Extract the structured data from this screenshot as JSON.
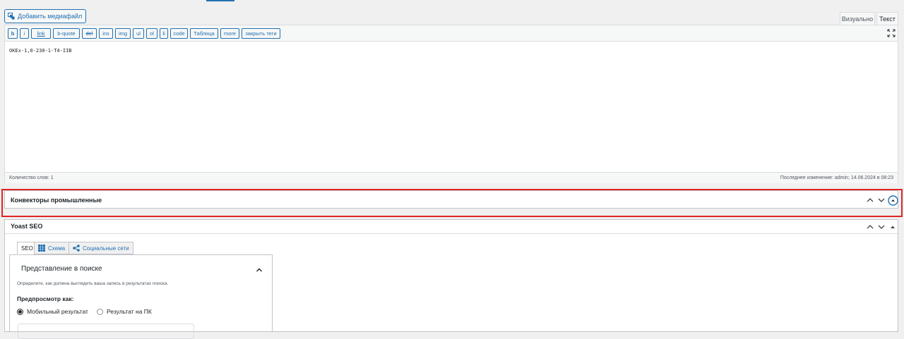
{
  "media_button": {
    "label": "Добавить медиафайл",
    "icon": "media-icon"
  },
  "editor_tabs": {
    "visual": "Визуально",
    "text": "Текст"
  },
  "quicktags": [
    "b",
    "i",
    "link",
    "b-quote",
    "del",
    "ins",
    "img",
    "ul",
    "ol",
    "li",
    "code",
    "Таблица",
    "more",
    "закрыть теги"
  ],
  "editor": {
    "content": "OKEx-1,0-230-1-T4-IIB"
  },
  "status": {
    "word_count": "Количество слов: 1",
    "last_modified": "Последнее изменение: admin; 14.06.2024 в 08:23"
  },
  "panel_conveyors": {
    "title": "Конвекторы промышленные"
  },
  "panel_yoast": {
    "title": "Yoast SEO",
    "tabs": [
      {
        "label": "SEO",
        "icon": ""
      },
      {
        "label": "Схема",
        "icon": "grid-icon"
      },
      {
        "label": "Социальные сети",
        "icon": "share-icon"
      }
    ],
    "section_title": "Представление в поиске",
    "hint": "Определите, как должна выглядеть ваша запись в результатах поиска.",
    "preview_label": "Предпросмотр как:",
    "radio_mobile": "Мобильный результат",
    "radio_desktop": "Результат на ПК"
  },
  "colors": {
    "accent": "#2271b1",
    "highlight": "#e02424",
    "background": "#f0f0f1"
  }
}
